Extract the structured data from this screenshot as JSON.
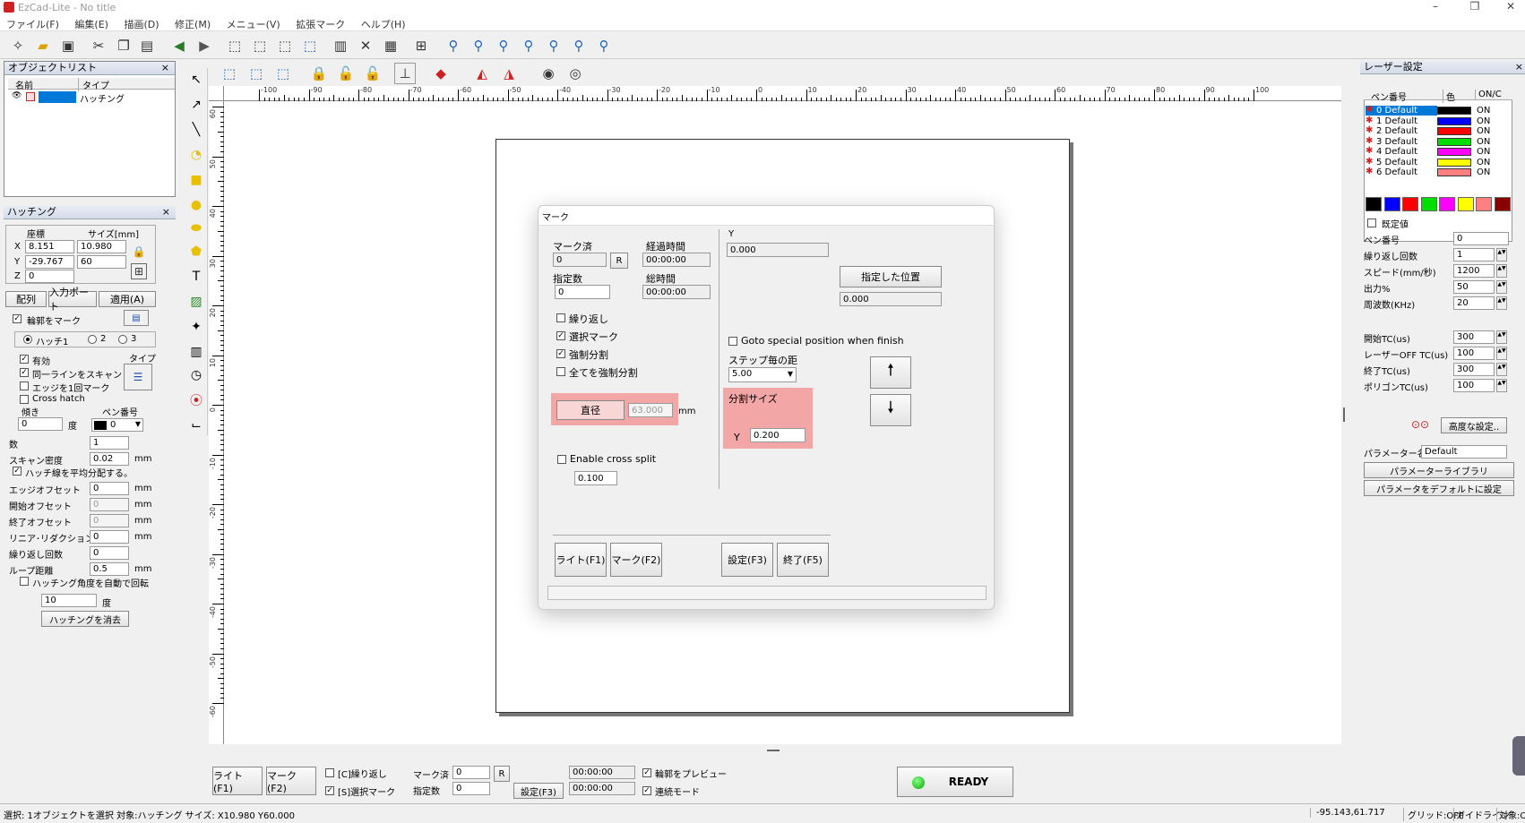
{
  "window": {
    "title": "EzCad-Lite - No title"
  },
  "menu": [
    "ファイル(F)",
    "編集(E)",
    "描画(D)",
    "修正(M)",
    "メニュー(V)",
    "拡張マーク",
    "ヘルプ(H)"
  ],
  "object_list": {
    "title": "オブジェクトリスト",
    "col_name": "名前",
    "col_type": "タイプ",
    "row_type": "ハッチング"
  },
  "hatch_panel": {
    "title": "ハッチング",
    "coord": "座標",
    "size": "サイズ[mm]",
    "x_label": "X",
    "y_label": "Y",
    "z_label": "Z",
    "x_val": "8.151",
    "y_val": "-29.767",
    "z_val": "0",
    "w_val": "10.980",
    "h_val": "60",
    "tab_array": "配列",
    "tab_import": "入力ポート",
    "tab_apply": "適用(A)",
    "mark_outline": "輪郭をマーク",
    "hatch1": "ハッチ1",
    "hatch2": "2",
    "hatch3": "3",
    "enable": "有効",
    "type_label": "タイプ",
    "same_line": "同一ラインをスキャン",
    "edge_once": "エッジを1回マーク",
    "cross_hatch": "Cross hatch",
    "angle_label": "傾き",
    "pen_label": "ペン番号",
    "angle_val": "0",
    "deg": "度",
    "pen_val": "0",
    "count_label": "数",
    "count_val": "1",
    "scan_density": "スキャン密度",
    "scan_val": "0.02",
    "mm": "mm",
    "even_dist": "ハッチ線を平均分配する。",
    "edge_offset": "エッジオフセット",
    "edge_val": "0",
    "start_offset": "開始オフセット",
    "start_val": "0",
    "end_offset": "終了オフセット",
    "end_val": "0",
    "linear_red": "リニア･リダクション",
    "linear_val": "0",
    "repeat": "繰り返し回数",
    "repeat_val": "0",
    "loop": "ループ距離",
    "loop_val": "0.5",
    "auto_rotate": "ハッチング角度を自動で回転",
    "rot_val": "10",
    "clear_hatch": "ハッチングを消去"
  },
  "dialog": {
    "title": "マーク",
    "marked": "マーク済",
    "marked_val": "0",
    "r": "R",
    "elapsed": "経過時間",
    "elapsed_val": "00:00:00",
    "specified": "指定数",
    "specified_val": "0",
    "total": "総時間",
    "total_val": "00:00:00",
    "repeat": "繰り返し",
    "select_mark": "選択マーク",
    "force_split": "強制分割",
    "all_force_split": "全てを強制分割",
    "diameter": "直径",
    "diameter_val": "63.000",
    "mm": "mm",
    "cross_split": "Enable cross split",
    "cross_val": "0.100",
    "y_label": "Y",
    "y_val": "0.000",
    "goto_pos": "指定した位置",
    "goto_val": "0.000",
    "goto_special": "Goto special position when finish",
    "step": "ステップ毎の距",
    "step_val": "5.00",
    "split_size": "分割サイズ",
    "split_y": "Y",
    "split_val": "0.200",
    "btn_light": "ライト(F1)",
    "btn_mark": "マーク(F2)",
    "btn_param": "設定(F3)",
    "btn_exit": "終了(F5)"
  },
  "bottom": {
    "light": "ライト(F1)",
    "mark": "マーク(F2)",
    "repeat": "[C]繰り返し",
    "select": "[S]選択マーク",
    "marked": "マーク済",
    "marked_val": "0",
    "r": "R",
    "specified": "指定数",
    "specified_val": "0",
    "param": "設定(F3)",
    "t1": "00:00:00",
    "t2": "00:00:00",
    "preview": "輪郭をプレビュー",
    "continuous": "連続モード",
    "ready": "READY"
  },
  "laser": {
    "title": "レーザー設定",
    "col_pen": "ペン番号",
    "col_color": "色",
    "col_on": "ON/C",
    "pens": [
      {
        "name": "0 Default",
        "color": "#000000",
        "on": "ON"
      },
      {
        "name": "1 Default",
        "color": "#0000ff",
        "on": "ON"
      },
      {
        "name": "2 Default",
        "color": "#ff0000",
        "on": "ON"
      },
      {
        "name": "3 Default",
        "color": "#00dd00",
        "on": "ON"
      },
      {
        "name": "4 Default",
        "color": "#ff00ff",
        "on": "ON"
      },
      {
        "name": "5 Default",
        "color": "#ffff00",
        "on": "ON"
      },
      {
        "name": "6 Default",
        "color": "#ff8080",
        "on": "ON"
      }
    ],
    "palette": [
      "#000000",
      "#0000ff",
      "#ff0000",
      "#00dd00",
      "#ff00ff",
      "#ffff00",
      "#ff8080",
      "#880000"
    ],
    "default": "既定値",
    "pen_no": "ペン番号",
    "pen_no_val": "0",
    "loop": "繰り返し回数",
    "loop_val": "1",
    "speed": "スピード(mm/秒)",
    "speed_val": "1200",
    "power": "出力%",
    "power_val": "50",
    "freq": "周波数(KHz)",
    "freq_val": "20",
    "start_tc": "開始TC(us)",
    "start_tc_val": "300",
    "off_tc": "レーザーOFF TC(us)",
    "off_tc_val": "100",
    "end_tc": "終了TC(us)",
    "end_tc_val": "300",
    "poly_tc": "ポリゴンTC(us)",
    "poly_tc_val": "100",
    "advanced": "高度な設定..",
    "param_name": "パラメーター名",
    "param_val": "Default",
    "library": "パラメーターライブラリ",
    "set_default": "パラメータをデフォルトに設定"
  },
  "status": {
    "text": "選択: 1オブジェクトを選択 対象:ハッチング サイズ: X10.980 Y60.000",
    "coord": "-95.143,61.717",
    "grid": "グリッド:OFF",
    "guide": "ガイドライン",
    "obj": "対象:OFF"
  },
  "ruler_h": [
    "-100",
    "-90",
    "-80",
    "-70",
    "-60",
    "-50",
    "-40",
    "-30",
    "-20",
    "-10",
    "0",
    "10",
    "20",
    "30",
    "40",
    "50",
    "60",
    "70",
    "80",
    "90",
    "100"
  ],
  "ruler_v": [
    "60",
    "50",
    "40",
    "30",
    "20",
    "10",
    "0",
    "-10",
    "-20",
    "-30",
    "-40",
    "-50",
    "-60"
  ]
}
